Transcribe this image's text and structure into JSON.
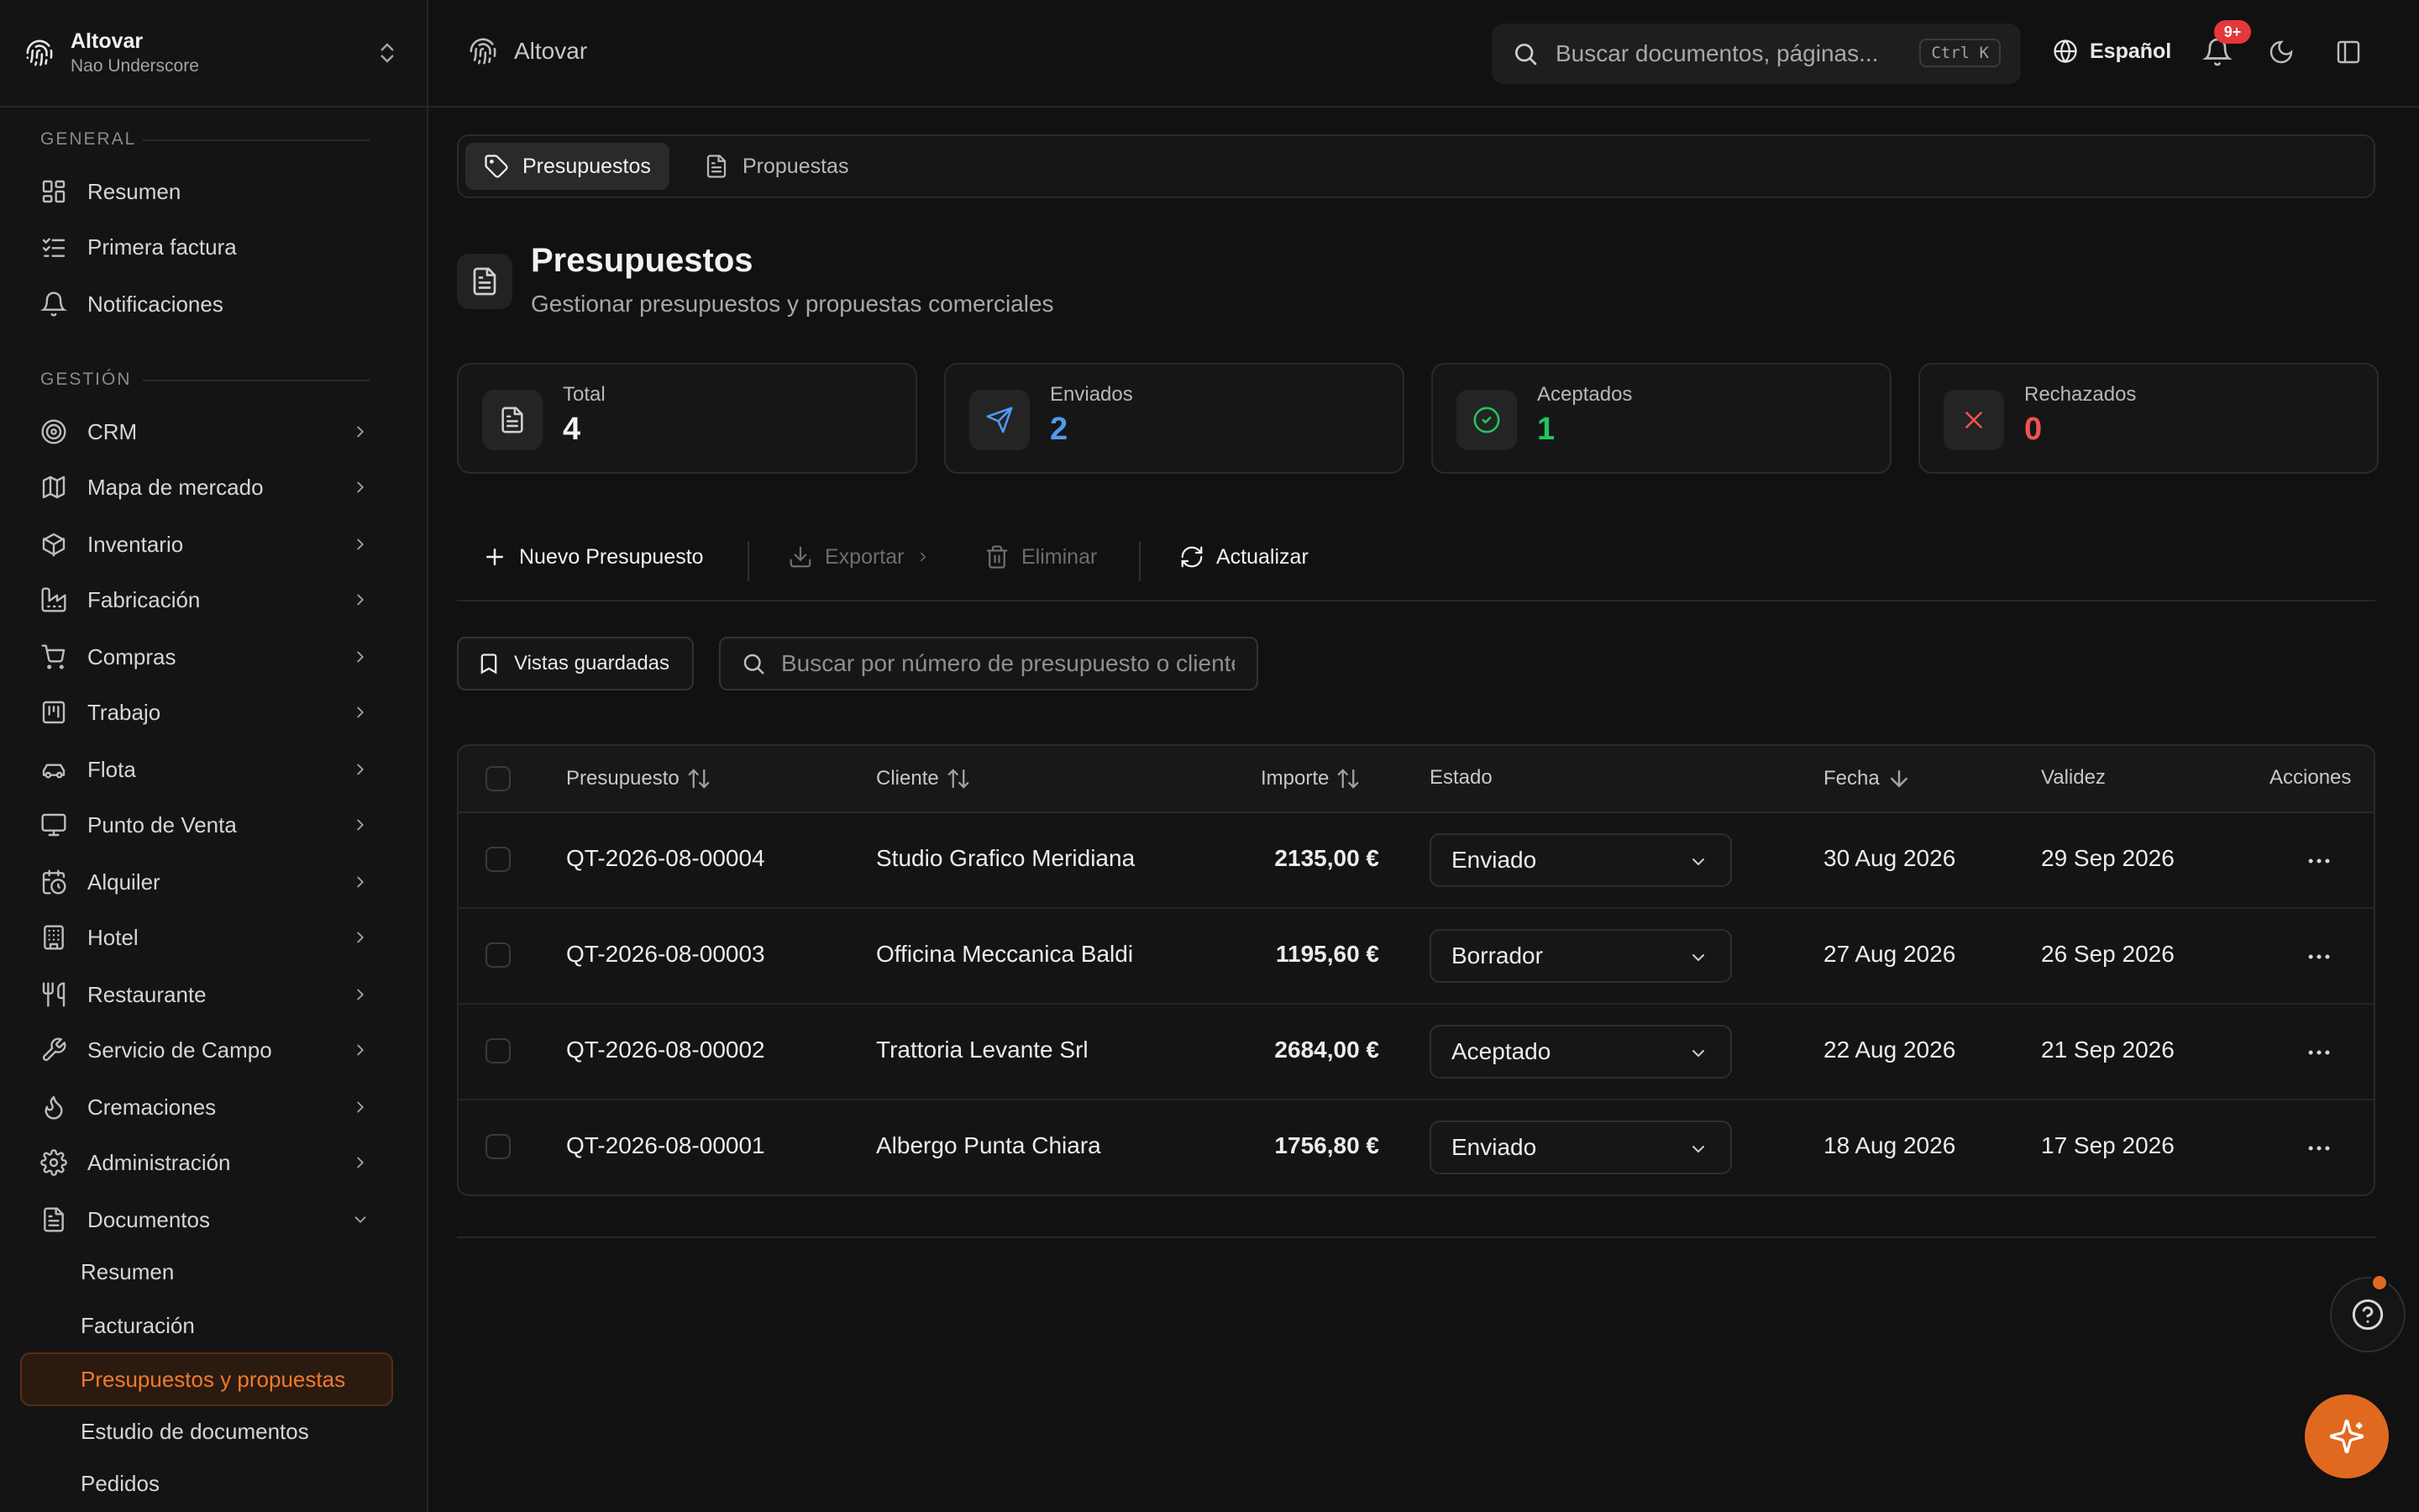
{
  "org": {
    "name": "Altovar",
    "user": "Nao Underscore"
  },
  "sidebar": {
    "section_general": "GENERAL",
    "general": [
      {
        "label": "Resumen",
        "icon": "dashboard-icon"
      },
      {
        "label": "Primera factura",
        "icon": "checklist-icon"
      },
      {
        "label": "Notificaciones",
        "icon": "bell-icon"
      }
    ],
    "section_gestion": "GESTIÓN",
    "gestion": [
      {
        "label": "CRM",
        "icon": "target-icon"
      },
      {
        "label": "Mapa de mercado",
        "icon": "map-icon"
      },
      {
        "label": "Inventario",
        "icon": "box-icon"
      },
      {
        "label": "Fabricación",
        "icon": "factory-icon"
      },
      {
        "label": "Compras",
        "icon": "cart-icon"
      },
      {
        "label": "Trabajo",
        "icon": "kanban-icon"
      },
      {
        "label": "Flota",
        "icon": "car-icon"
      },
      {
        "label": "Punto de Venta",
        "icon": "monitor-icon"
      },
      {
        "label": "Alquiler",
        "icon": "calendar-clock-icon"
      },
      {
        "label": "Hotel",
        "icon": "building-icon"
      },
      {
        "label": "Restaurante",
        "icon": "utensils-icon"
      },
      {
        "label": "Servicio de Campo",
        "icon": "wrench-icon"
      },
      {
        "label": "Cremaciones",
        "icon": "flame-icon"
      },
      {
        "label": "Administración",
        "icon": "gear-icon"
      },
      {
        "label": "Documentos",
        "icon": "file-icon"
      }
    ],
    "documentos_sub": [
      "Resumen",
      "Facturación",
      "Presupuestos y propuestas",
      "Estudio de documentos",
      "Pedidos"
    ]
  },
  "topbar": {
    "breadcrumb": "Altovar",
    "search_placeholder": "Buscar documentos, páginas...",
    "shortcut": "Ctrl K",
    "language": "Español",
    "notif_badge": "9+"
  },
  "tabs": [
    "Presupuestos",
    "Propuestas"
  ],
  "page": {
    "title": "Presupuestos",
    "subtitle": "Gestionar presupuestos y propuestas comerciales"
  },
  "stats": [
    {
      "label": "Total",
      "value": "4",
      "color": "#f2f2f2",
      "icon": "file-icon"
    },
    {
      "label": "Enviados",
      "value": "2",
      "color": "#4f9bf0",
      "icon": "send-icon"
    },
    {
      "label": "Aceptados",
      "value": "1",
      "color": "#22c55e",
      "icon": "check-circle-icon"
    },
    {
      "label": "Rechazados",
      "value": "0",
      "color": "#ef5350",
      "icon": "x-icon"
    }
  ],
  "toolbar": {
    "new": "Nuevo Presupuesto",
    "export": "Exportar",
    "delete": "Eliminar",
    "refresh": "Actualizar"
  },
  "filters": {
    "saved_views": "Vistas guardadas",
    "search_placeholder": "Buscar por número de presupuesto o cliente"
  },
  "table": {
    "headers": {
      "quote": "Presupuesto",
      "client": "Cliente",
      "amount": "Importe",
      "status": "Estado",
      "date": "Fecha",
      "validity": "Validez",
      "actions": "Acciones"
    },
    "rows": [
      {
        "quote": "QT-2026-08-00004",
        "client": "Studio Grafico Meridiana",
        "amount": "2135,00 €",
        "status": "Enviado",
        "date": "30 Aug 2026",
        "validity": "29 Sep 2026"
      },
      {
        "quote": "QT-2026-08-00003",
        "client": "Officina Meccanica Baldi",
        "amount": "1195,60 €",
        "status": "Borrador",
        "date": "27 Aug 2026",
        "validity": "26 Sep 2026"
      },
      {
        "quote": "QT-2026-08-00002",
        "client": "Trattoria Levante Srl",
        "amount": "2684,00 €",
        "status": "Aceptado",
        "date": "22 Aug 2026",
        "validity": "21 Sep 2026"
      },
      {
        "quote": "QT-2026-08-00001",
        "client": "Albergo Punta Chiara",
        "amount": "1756,80 €",
        "status": "Enviado",
        "date": "18 Aug 2026",
        "validity": "17 Sep 2026"
      }
    ]
  },
  "colors": {
    "accent": "#e0691f",
    "sent": "#4f9bf0",
    "accepted": "#22c55e",
    "rejected": "#ef5350"
  }
}
